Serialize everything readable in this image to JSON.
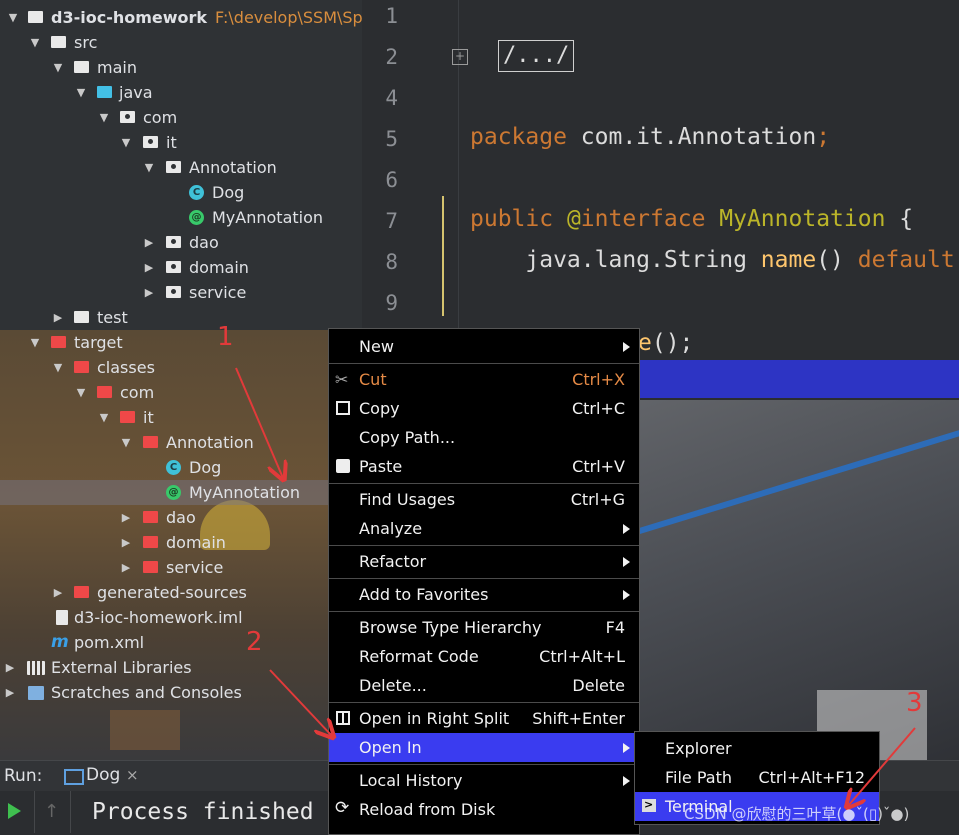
{
  "project_tree": {
    "root": {
      "name": "d3-ioc-homework",
      "path": "F:\\develop\\SSM\\Spri"
    },
    "src": "src",
    "main": "main",
    "java": "java",
    "com": "com",
    "it": "it",
    "annotation_pkg": "Annotation",
    "dog": "Dog",
    "my_annotation": "MyAnnotation",
    "dao": "dao",
    "domain": "domain",
    "service": "service",
    "test": "test",
    "target": "target",
    "classes": "classes",
    "t_com": "com",
    "t_it": "it",
    "t_annotation": "Annotation",
    "t_dog": "Dog",
    "t_my_annotation": "MyAnnotation",
    "t_dao": "dao",
    "t_domain": "domain",
    "t_service": "service",
    "generated_sources": "generated-sources",
    "iml": "d3-ioc-homework.iml",
    "pom": "pom.xml",
    "external_libraries": "External Libraries",
    "scratches": "Scratches and Consoles",
    "maven_letter": "m",
    "class_letter": "C",
    "annotation_letter": "@"
  },
  "editor": {
    "line_numbers": [
      "1",
      "2",
      "4",
      "5",
      "6",
      "7",
      "8",
      "9"
    ],
    "fold_marker": "+",
    "collapsed_import": "/.../",
    "line5": {
      "kw": "package",
      "rest": " com.it.Annotation",
      "semi": ";"
    },
    "line7": {
      "kw": "public",
      "at": " @",
      "kw2": "interface",
      "name": " MyAnnotation",
      "brace": " {"
    },
    "line8": {
      "type": "    java.lang.String ",
      "method": "name",
      "parens": "() ",
      "kw": "default"
    },
    "line_partial": {
      "text": "e",
      "rest": "();"
    }
  },
  "context_menu": {
    "items": [
      {
        "label": "New",
        "shortcut": "",
        "submenu": true
      },
      {
        "label": "Cut",
        "shortcut": "Ctrl+X"
      },
      {
        "label": "Copy",
        "shortcut": "Ctrl+C"
      },
      {
        "label": "Copy Path...",
        "shortcut": ""
      },
      {
        "label": "Paste",
        "shortcut": "Ctrl+V"
      },
      {
        "label": "Find Usages",
        "shortcut": "Ctrl+G"
      },
      {
        "label": "Analyze",
        "shortcut": "",
        "submenu": true
      },
      {
        "label": "Refactor",
        "shortcut": "",
        "submenu": true
      },
      {
        "label": "Add to Favorites",
        "shortcut": "",
        "submenu": true
      },
      {
        "label": "Browse Type Hierarchy",
        "shortcut": "F4"
      },
      {
        "label": "Reformat Code",
        "shortcut": "Ctrl+Alt+L"
      },
      {
        "label": "Delete...",
        "shortcut": "Delete"
      },
      {
        "label": "Open in Right Split",
        "shortcut": "Shift+Enter"
      },
      {
        "label": "Open In",
        "shortcut": "",
        "submenu": true,
        "highlighted": true
      },
      {
        "label": "Local History",
        "shortcut": "",
        "submenu": true
      },
      {
        "label": "Reload from Disk",
        "shortcut": ""
      }
    ]
  },
  "submenu": {
    "items": [
      {
        "label": "Explorer",
        "shortcut": ""
      },
      {
        "label": "File Path",
        "shortcut": "Ctrl+Alt+F12"
      },
      {
        "label": "Terminal",
        "shortcut": "",
        "highlighted": true
      }
    ]
  },
  "run_bar": {
    "label": "Run:",
    "tab_label": "Dog",
    "close": "×"
  },
  "console": {
    "output": "Process finished",
    "up_arrow": "↑"
  },
  "annotations": {
    "n1": "1",
    "n2": "2",
    "n3": "3",
    "color": "#e23a3a"
  },
  "watermark": "CSDN @欣慰的三叶草(●ˇ(▯)ˇ●)"
}
